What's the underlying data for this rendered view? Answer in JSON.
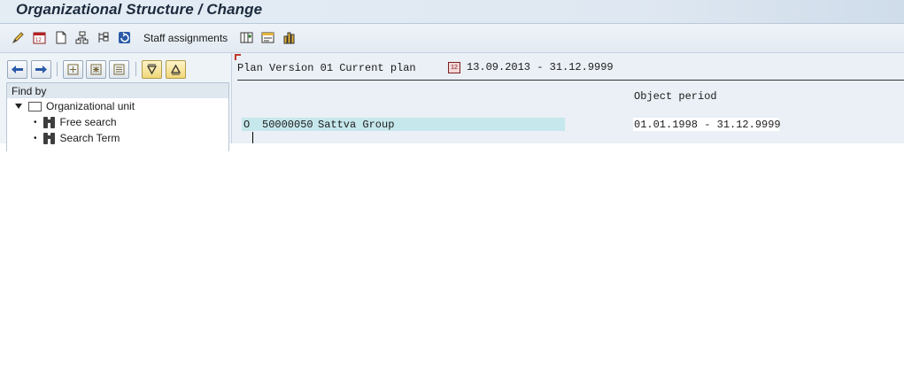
{
  "window": {
    "title": "Organizational Structure / Change"
  },
  "toolbar": {
    "icons": [
      "pencil-icon",
      "calendar-icon",
      "document-icon",
      "hierarchy-icon",
      "structure-icon",
      "refresh-icon"
    ],
    "staff_assignments_label": "Staff assignments",
    "trailing_icons": [
      "add-column-icon",
      "details-icon",
      "graphic-icon"
    ]
  },
  "left_panel": {
    "nav_buttons": [
      "back-arrow-icon",
      "forward-arrow-icon",
      "expand-icon",
      "collapse-icon",
      "subtree-icon",
      "sort-down-icon",
      "sort-up-icon"
    ],
    "find_by_label": "Find by",
    "tree": {
      "root": "Organizational unit",
      "children": [
        "Free search",
        "Search Term"
      ]
    }
  },
  "main_panel": {
    "plan_version": "Plan Version 01 Current plan",
    "period": "13.09.2013 - 31.12.9999",
    "column_header": "Object period",
    "rows": [
      {
        "type": "O",
        "id": "50000050",
        "name": "Sattva Group",
        "object_period": "01.01.1998 - 31.12.9999"
      }
    ]
  },
  "colors": {
    "selection": "#c6e7ec",
    "panel_bg": "#eaf0f6",
    "title_bg": "#dfe8f2"
  }
}
